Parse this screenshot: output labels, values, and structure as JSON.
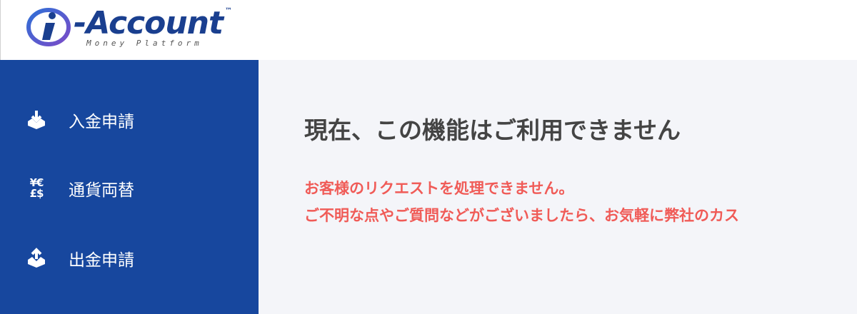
{
  "brand": {
    "name": "-Account",
    "tm": "™",
    "tagline": "Money Platform",
    "colors": {
      "primary": "#1a3f8f",
      "accent": "#7a4cc8"
    }
  },
  "sidebar": {
    "background": "#17479e",
    "items": [
      {
        "label": "入金申請",
        "icon": "deposit-icon"
      },
      {
        "label": "通貨両替",
        "icon": "currency-exchange-icon"
      },
      {
        "label": "出金申請",
        "icon": "withdraw-icon"
      }
    ]
  },
  "main": {
    "title": "現在、この機能はご利用できません",
    "messages": [
      "お客様のリクエストを処理できません。",
      "ご不明な点やご質問などがございましたら、お気軽に弊社のカス"
    ],
    "error_color": "#f05b57"
  }
}
